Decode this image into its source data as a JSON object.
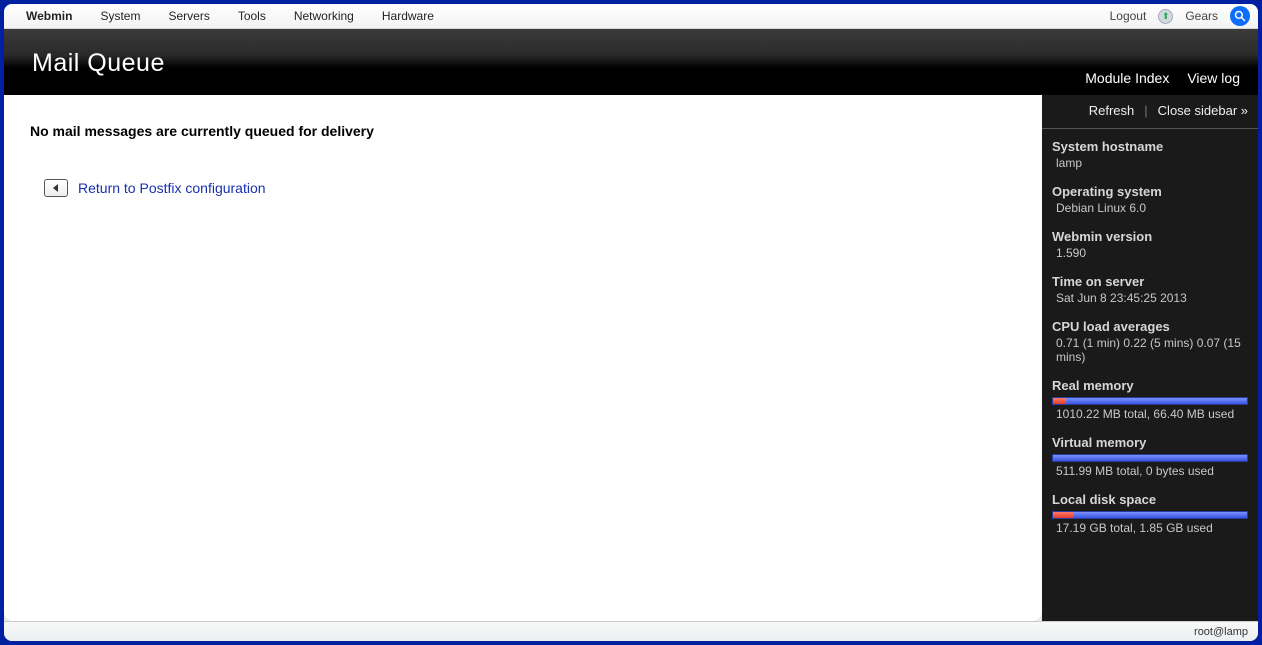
{
  "menubar": {
    "items": [
      "Webmin",
      "System",
      "Servers",
      "Tools",
      "Networking",
      "Hardware"
    ],
    "active_index": 0,
    "logout": "Logout",
    "gears": "Gears"
  },
  "header": {
    "title": "Mail Queue",
    "module_index": "Module Index",
    "view_log": "View log"
  },
  "main": {
    "empty_message": "No mail messages are currently queued for delivery",
    "return_link": "Return to Postfix configuration"
  },
  "sidebar": {
    "refresh": "Refresh",
    "close": "Close sidebar »",
    "hostname": {
      "label": "System hostname",
      "value": "lamp"
    },
    "os": {
      "label": "Operating system",
      "value": "Debian Linux 6.0"
    },
    "version": {
      "label": "Webmin version",
      "value": "1.590"
    },
    "time": {
      "label": "Time on server",
      "value": "Sat Jun 8 23:45:25 2013"
    },
    "cpu": {
      "label": "CPU load averages",
      "value": "0.71 (1 min) 0.22 (5 mins) 0.07 (15 mins)"
    },
    "real_memory": {
      "label": "Real memory",
      "value": "1010.22 MB total, 66.40 MB used",
      "used_pct": 6.6
    },
    "virtual_memory": {
      "label": "Virtual memory",
      "value": "511.99 MB total, 0 bytes used",
      "used_pct": 0
    },
    "disk": {
      "label": "Local disk space",
      "value": "17.19 GB total, 1.85 GB used",
      "used_pct": 10.8
    }
  },
  "statusbar": {
    "user": "root@lamp"
  }
}
